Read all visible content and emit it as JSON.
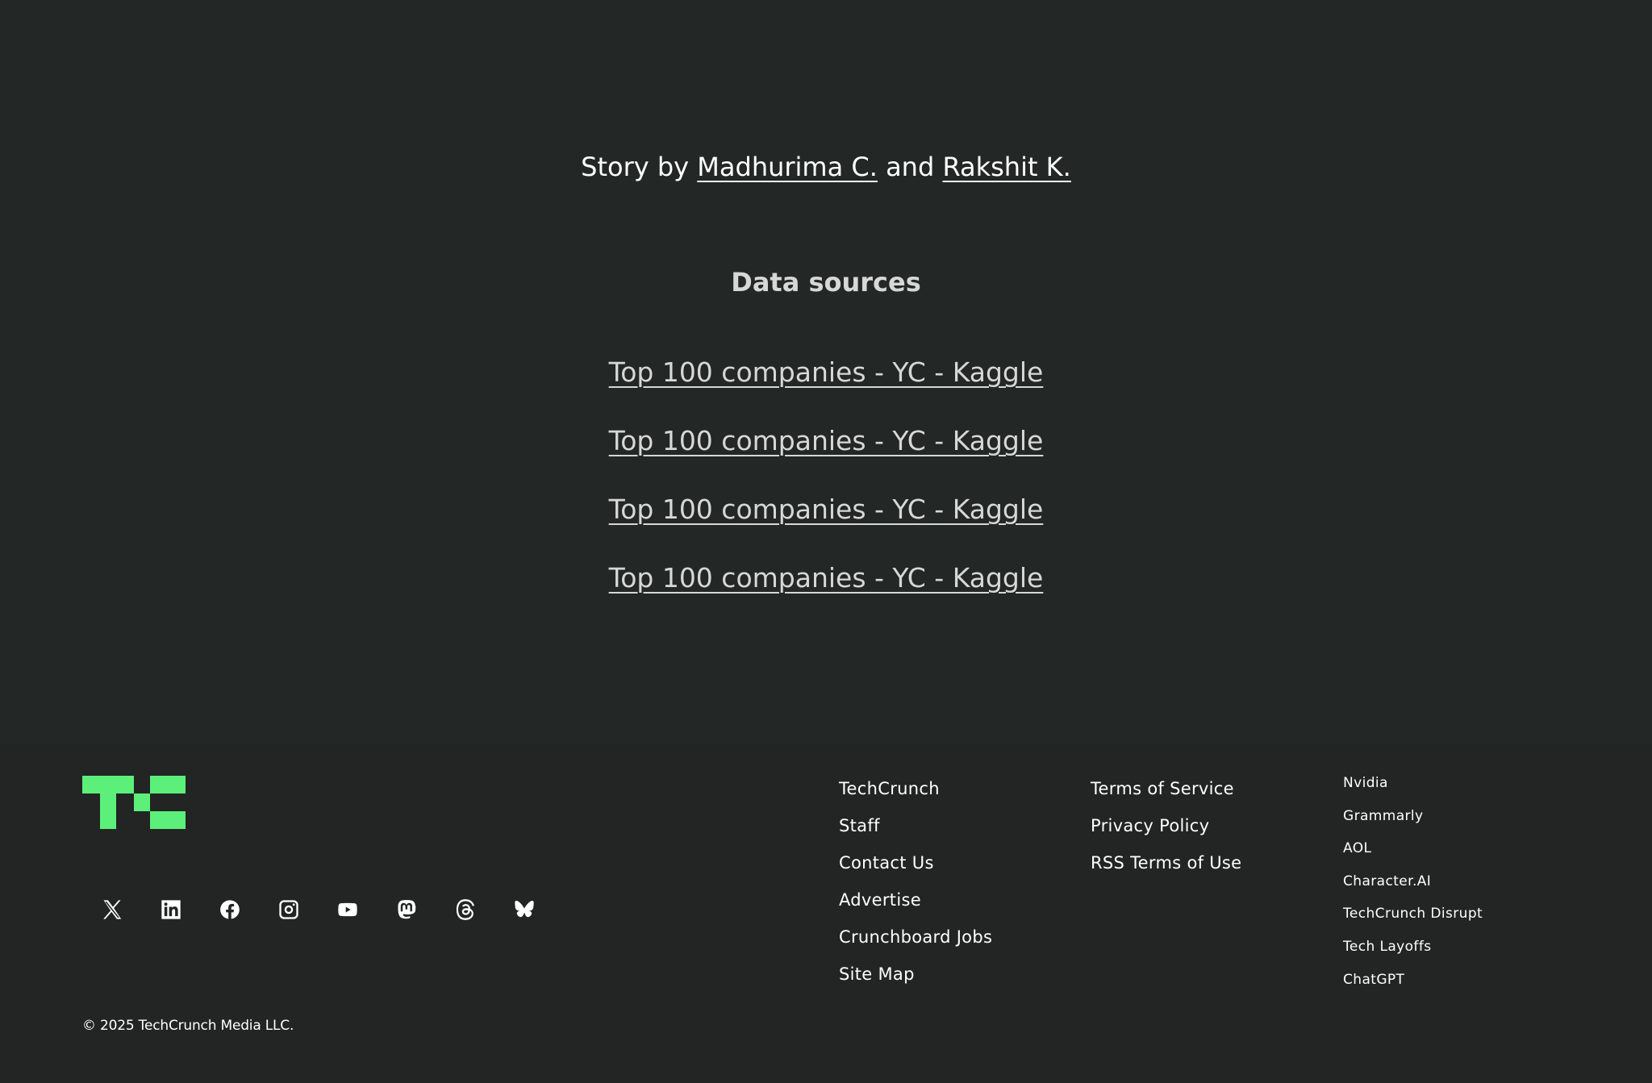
{
  "credits": {
    "prefix": "Story by",
    "author_1": "Madhurima C.",
    "conjunction": "and",
    "author_2": "Rakshit K."
  },
  "sources": {
    "heading": "Data sources",
    "links": [
      "Top 100 companies - YC - Kaggle",
      "Top 100 companies - YC - Kaggle",
      "Top 100 companies - YC - Kaggle",
      "Top 100 companies - YC - Kaggle"
    ]
  },
  "footer": {
    "brand_color": "#5cf07a",
    "social_icons": [
      "x-icon",
      "linkedin-icon",
      "facebook-icon",
      "instagram-icon",
      "youtube-icon",
      "mastodon-icon",
      "threads-icon",
      "bluesky-icon"
    ],
    "col_1": [
      "TechCrunch",
      "Staff",
      "Contact Us",
      "Advertise",
      "Crunchboard Jobs",
      "Site Map"
    ],
    "col_2": [
      "Terms of Service",
      "Privacy Policy",
      "RSS Terms of Use"
    ],
    "col_3": [
      "Nvidia",
      "Grammarly",
      "AOL",
      "Character.AI",
      "TechCrunch Disrupt",
      "Tech Layoffs",
      "ChatGPT"
    ],
    "copyright": "© 2025 TechCrunch Media LLC."
  }
}
